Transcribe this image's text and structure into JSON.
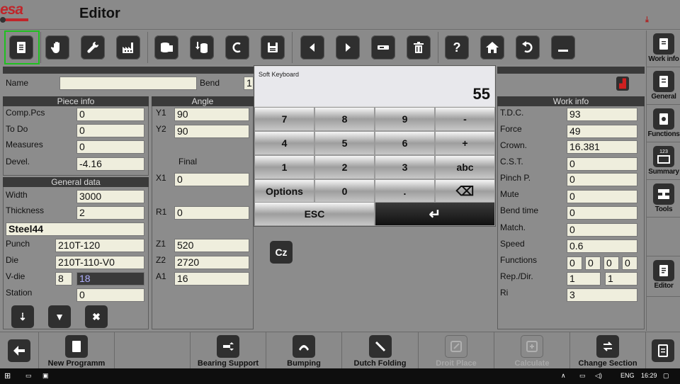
{
  "app": {
    "logo": "esa",
    "title": "Editor"
  },
  "toolbar": {
    "buttons": [
      "document",
      "hand",
      "wrench",
      "factory",
      "database",
      "database-arrow",
      "c-letter",
      "save",
      "arrow-left",
      "arrow-right",
      "minus",
      "trash",
      "help",
      "home",
      "undo",
      "minimize"
    ]
  },
  "right_panel": {
    "items": [
      "Work info",
      "General",
      "Functions",
      "Summary",
      "Tools",
      "Editor"
    ],
    "summary_icon_text": "123"
  },
  "header": {
    "name_label": "Name",
    "name_value": "",
    "bend_label": "Bend",
    "bend_value": "1"
  },
  "piece_info": {
    "title": "Piece info",
    "rows": [
      {
        "label": "Comp.Pcs",
        "value": "0"
      },
      {
        "label": "To Do",
        "value": "0"
      },
      {
        "label": "Measures",
        "value": "0"
      },
      {
        "label": "Devel.",
        "value": "-4.16"
      }
    ]
  },
  "general_data": {
    "title": "General data",
    "width_label": "Width",
    "width_value": "3000",
    "thickness_label": "Thickness",
    "thickness_value": "2",
    "material_value": "Steel44",
    "punch_label": "Punch",
    "punch_value": "210T-120",
    "die_label": "Die",
    "die_value": "210T-110-V0",
    "vdie_label": "V-die",
    "vdie_value1": "8",
    "vdie_value2": "18",
    "station_label": "Station",
    "station_value": "0"
  },
  "angle": {
    "title": "Angle",
    "y1_label": "Y1",
    "y1_value": "90",
    "y2_label": "Y2",
    "y2_value": "90",
    "final_label": "Final",
    "x1_label": "X1",
    "x1_value": "0",
    "r1_label": "R1",
    "r1_value": "0",
    "z1_label": "Z1",
    "z1_value": "520",
    "z2_label": "Z2",
    "z2_value": "2720",
    "a1_label": "A1",
    "a1_value": "16"
  },
  "cz_button": "Cz",
  "work_info": {
    "title": "Work info",
    "rows": [
      {
        "label": "T.D.C.",
        "value": "93"
      },
      {
        "label": "Force",
        "value": "49"
      },
      {
        "label": "Crown.",
        "value": "16.381"
      },
      {
        "label": "C.S.T.",
        "value": "0"
      },
      {
        "label": "Pinch P.",
        "value": "0"
      },
      {
        "label": "Mute",
        "value": "0"
      },
      {
        "label": "Bend time",
        "value": "0"
      },
      {
        "label": "Match.",
        "value": "0"
      },
      {
        "label": "Speed",
        "value": "0.6"
      }
    ],
    "functions_label": "Functions",
    "functions_values": [
      "0",
      "0",
      "0",
      "0"
    ],
    "repdir_label": "Rep./Dir.",
    "repdir_values": [
      "1",
      "1"
    ],
    "ri_label": "Ri",
    "ri_value": "3"
  },
  "keyboard": {
    "title": "Soft Keyboard",
    "value": "55",
    "keys": [
      "7",
      "8",
      "9",
      "-",
      "4",
      "5",
      "6",
      "+",
      "1",
      "2",
      "3",
      "abc",
      "Options",
      "0",
      ".",
      "⌫"
    ],
    "esc": "ESC",
    "enter": "↵"
  },
  "bottom_bar": {
    "items": [
      {
        "label": "",
        "icon": "back-arrow",
        "enabled": true
      },
      {
        "label": "New Programm",
        "icon": "document",
        "enabled": true
      },
      {
        "label": "",
        "icon": "",
        "enabled": true
      },
      {
        "label": "Bearing Support",
        "icon": "bearing",
        "enabled": true
      },
      {
        "label": "Bumping",
        "icon": "bumping",
        "enabled": true
      },
      {
        "label": "Dutch Folding",
        "icon": "folding",
        "enabled": true
      },
      {
        "label": "Droit Place",
        "icon": "edit",
        "enabled": false
      },
      {
        "label": "Calculate",
        "icon": "calculate",
        "enabled": false
      },
      {
        "label": "Change Section",
        "icon": "swap",
        "enabled": true
      },
      {
        "label": "",
        "icon": "list",
        "enabled": true
      }
    ]
  },
  "taskbar": {
    "lang": "ENG",
    "time": "16:29"
  }
}
